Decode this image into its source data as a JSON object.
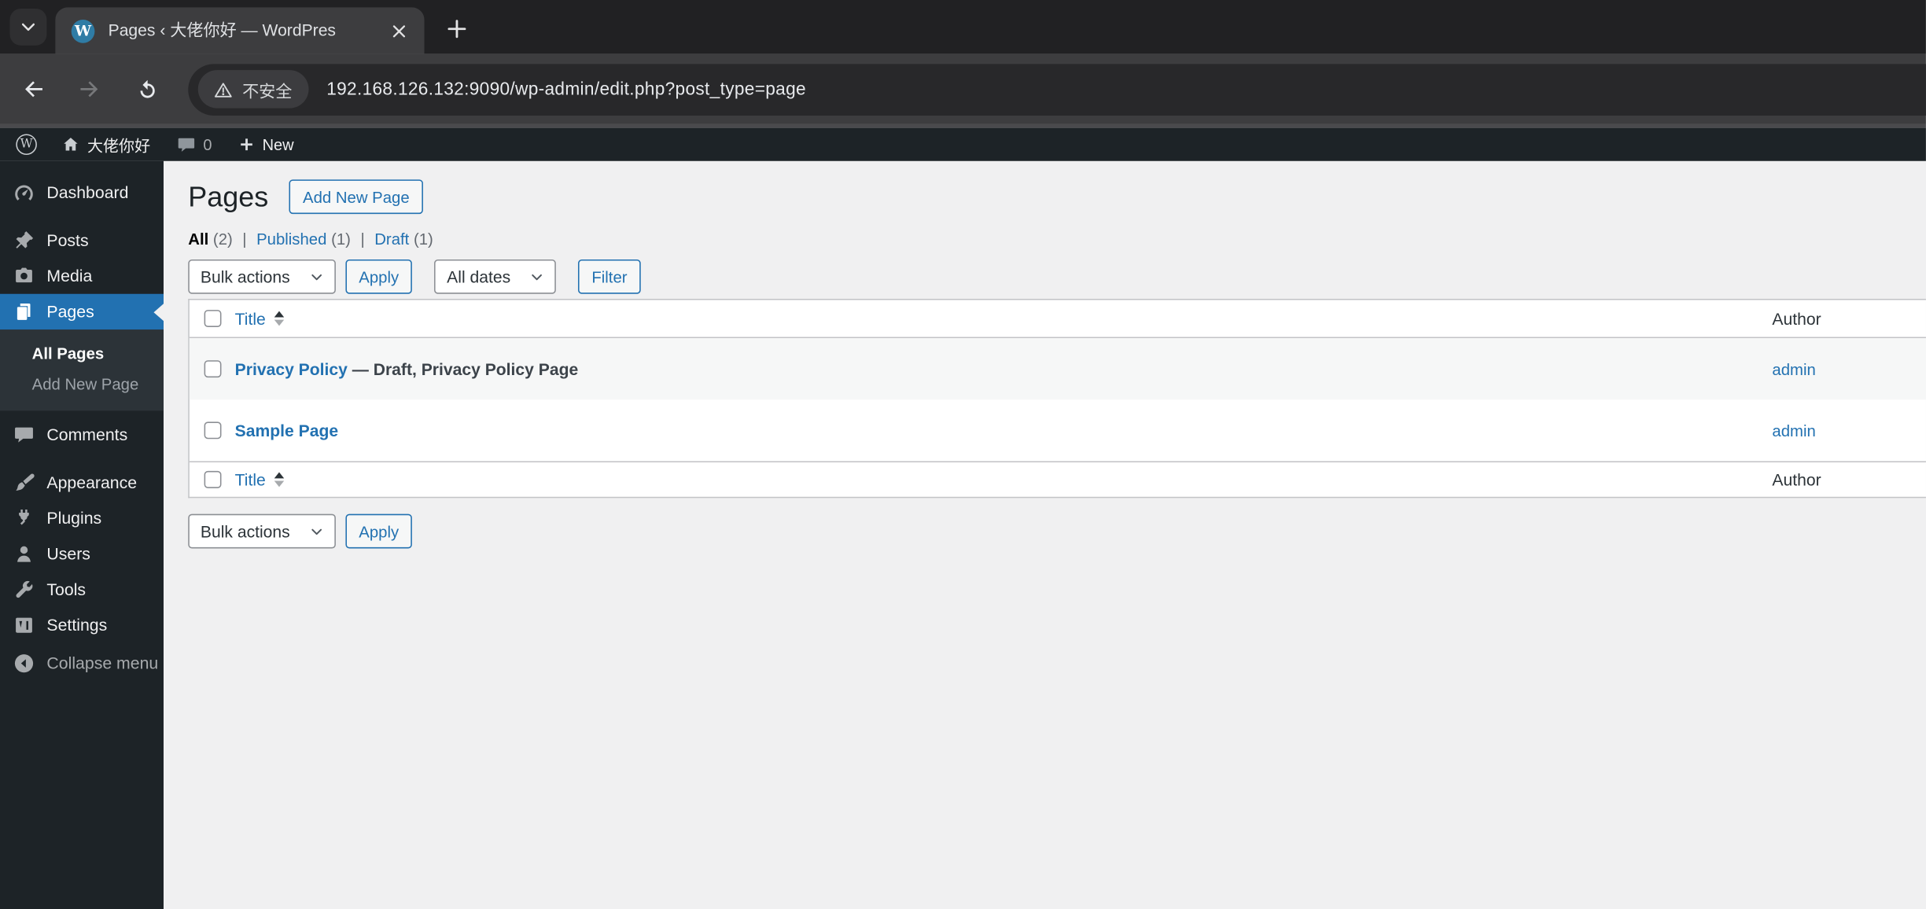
{
  "browser": {
    "tab_title": "Pages ‹ 大佬你好 — WordPres",
    "favicon_letter": "W",
    "security_label": "不安全",
    "url": "192.168.126.132:9090/wp-admin/edit.php?post_type=page"
  },
  "admin_bar": {
    "logo_letter": "W",
    "site_name": "大佬你好",
    "comment_count": "0",
    "new_label": "New"
  },
  "sidebar": {
    "items": [
      {
        "label": "Dashboard"
      },
      {
        "label": "Posts"
      },
      {
        "label": "Media"
      },
      {
        "label": "Pages"
      },
      {
        "label": "Comments"
      },
      {
        "label": "Appearance"
      },
      {
        "label": "Plugins"
      },
      {
        "label": "Users"
      },
      {
        "label": "Tools"
      },
      {
        "label": "Settings"
      }
    ],
    "pages_submenu": [
      {
        "label": "All Pages"
      },
      {
        "label": "Add New Page"
      }
    ],
    "collapse_label": "Collapse menu"
  },
  "main": {
    "title": "Pages",
    "add_new_label": "Add New Page",
    "filters": {
      "all_label": "All",
      "all_count": "(2)",
      "separator": "|",
      "published_label": "Published",
      "published_count": "(1)",
      "draft_label": "Draft",
      "draft_count": "(1)"
    },
    "toolbar": {
      "bulk_actions_label": "Bulk actions",
      "apply_label": "Apply",
      "dates_label": "All dates",
      "filter_label": "Filter"
    },
    "table": {
      "title_column": "Title",
      "author_column": "Author",
      "rows": [
        {
          "title": "Privacy Policy",
          "state": " — Draft, Privacy Policy Page",
          "author": "admin"
        },
        {
          "title": "Sample Page",
          "state": "",
          "author": "admin"
        }
      ]
    }
  },
  "colors": {
    "accent_blue": "#2271b1",
    "admin_dark": "#1d2327",
    "submenu_dark": "#2c3338",
    "content_bg": "#f0f0f1",
    "striped_row": "#f6f7f7"
  }
}
